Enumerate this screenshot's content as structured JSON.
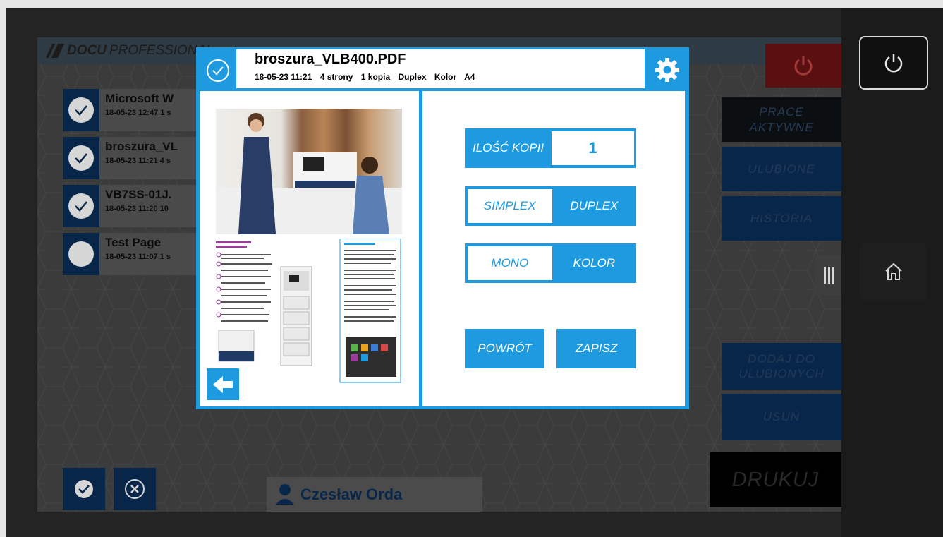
{
  "app": {
    "logo_bold": "DOCU",
    "logo_light": "PROFESSIONAL"
  },
  "jobs": [
    {
      "name": "Microsoft W",
      "meta": "18-05-23 12:47  1 s",
      "checked": true
    },
    {
      "name": "broszura_VL",
      "meta": "18-05-23 11:21  4 s",
      "checked": true
    },
    {
      "name": "VB7SS-01J.",
      "meta": "18-05-23 11:20  10",
      "checked": true
    },
    {
      "name": "Test Page",
      "meta": "18-05-23 11:07  1 s",
      "checked": false
    }
  ],
  "sidebar": {
    "active_jobs": "PRACE\nAKTYWNE",
    "favorites": "ULUBIONE",
    "history": "HISTORIA",
    "add_favorites": "DODAJ DO\nULUBIONYCH",
    "delete": "USUŃ",
    "print": "DRUKUJ"
  },
  "user": {
    "name": "Czesław Orda"
  },
  "modal": {
    "filename": "broszura_VLB400.PDF",
    "date": "18-05-23 11:21",
    "pages": "4 strony",
    "copies": "1 kopia",
    "mode": "Duplex",
    "color": "Kolor",
    "paper": "A4",
    "copies_label": "ILOŚĆ KOPII",
    "copies_value": "1",
    "simplex": "SIMPLEX",
    "duplex": "DUPLEX",
    "mono": "MONO",
    "kolor": "KOLOR",
    "back": "POWRÓT",
    "save": "ZAPISZ"
  },
  "colors": {
    "accent": "#1e9be0",
    "navy": "#07264a",
    "power_red": "#5a1010"
  }
}
